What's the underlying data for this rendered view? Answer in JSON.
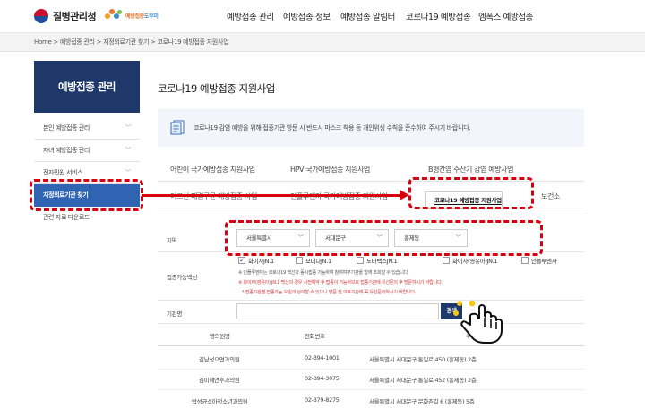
{
  "header": {
    "logo_text": "질병관리청",
    "sub_logo": {
      "part1": "예방접종",
      "part2": "도우미"
    },
    "nav": [
      "예방접종 관리",
      "예방접종 정보",
      "예방접종 알림터",
      "코로나19 예방접종",
      "엠폭스 예방접종"
    ]
  },
  "breadcrumb": "Home > 예방접종 관리 > 지정의료기관 찾기 > 코로나19 예방접종 지원사업",
  "sidebar": {
    "title": "예방접종 관리",
    "items": [
      {
        "label": "본인 예방접종 관리"
      },
      {
        "label": "자녀 예방접종 관리"
      },
      {
        "label": "전자민원 서비스"
      },
      {
        "label": "지정의료기관 찾기"
      },
      {
        "label": "관련 자료 다운로드"
      }
    ]
  },
  "main": {
    "title": "코로나19 예방접종 지원사업",
    "notice": "코로나19 감염 예방을 위해 접종기관 방문 시 반드시 마스크 착용 등 개인위생 수칙을 준수하여 주시기 바랍니다.",
    "tabs_row1": [
      "어린이 국가예방접종 지원사업",
      "HPV 국가예방접종 지원사업",
      "B형간염 주산기 감염 예방사업"
    ],
    "tabs_row2": [
      "어르신 폐렴구균 예방접종 사업",
      "인플루엔자 국가예방접종 지원사업",
      "코로나19 예방접종 지원사업",
      "보건소"
    ]
  },
  "form": {
    "region_label": "지역",
    "region": {
      "sido": "서울특별시",
      "sigungu": "서대문구",
      "dong": "홍제동"
    },
    "vaccine_label": "접종가능백신",
    "vaccines": [
      {
        "label": "화이자JN.1",
        "checked": true
      },
      {
        "label": "모더나JN.1",
        "checked": false
      },
      {
        "label": "노바백스JN.1",
        "checked": false
      },
      {
        "label": "화이자(영유아)JN.1",
        "checked": false
      },
      {
        "label": "인플루엔자",
        "checked": false
      }
    ],
    "check_mark": "✓",
    "notes": [
      "※ 인플루엔자는 코로나19 백신과 동시접종 가능하여 참여여부기관을 함께 조회할 수 있습니다.",
      "※ 화이자(영유아) JN.1 백신의 경우 사전예약 후 접종이 가능하므로 접종기관에 유선문의 후 방문하시기 바랍니다.",
      "* 접종기관별 접종가능 요일과 상이할 수 있으니 방문 전 의료기관에 꼭 유선문의하시기 바랍니다."
    ],
    "name_label": "기관명",
    "search_label": "검색"
  },
  "results": {
    "headers": [
      "병의원명",
      "전화번호",
      "주소"
    ],
    "rows": [
      [
        "김남성으면과의원",
        "02-394-1001",
        "서울특별시 서대문구 통일로 450 (홍제동) 2층"
      ],
      [
        "김미혜연후과의원",
        "02-394-3075",
        "서울특별시 서대문구 통일로 452 (홍제동) 2층"
      ],
      [
        "박성균소아청소년과의원",
        "02-379-8275",
        "서울특별시 서대문구 문화촌길 6 (홍제동) 5층"
      ]
    ]
  },
  "colors": {
    "navy": "#1d3869",
    "active_blue": "#2f64b3",
    "annotation_red": "#d7000f",
    "notice_bg": "#f2f6fb"
  }
}
